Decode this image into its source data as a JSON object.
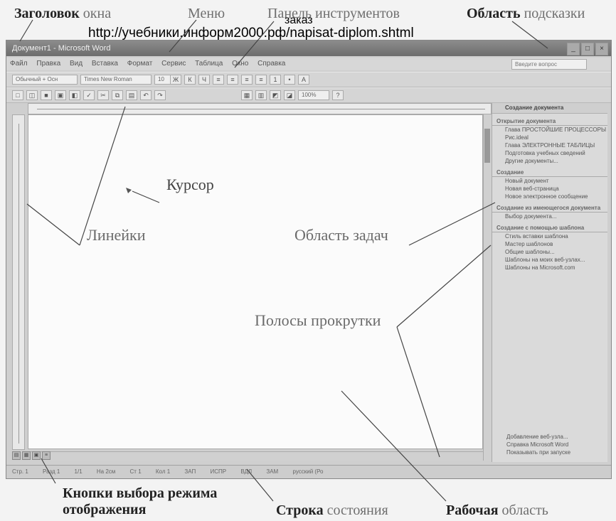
{
  "overlay": {
    "word": "заказ",
    "url": "http://учебники.информ2000.рф/napisat-diplom.shtml"
  },
  "top_labels": {
    "title_window_bold": "Заголовок",
    "title_window_rest": "окна",
    "menu": "Меню",
    "toolbar": "Панель инструментов",
    "help_bold": "Область",
    "help_rest": "подсказки"
  },
  "window": {
    "title": "Документ1 - Microsoft Word",
    "menu_items": [
      "Файл",
      "Правка",
      "Вид",
      "Вставка",
      "Формат",
      "Сервис",
      "Таблица",
      "Окно",
      "Справка"
    ],
    "help_box": "Введите вопрос",
    "toolbar_style": "Обычный + Осн",
    "toolbar_font": "Times New Roman",
    "toolbar_size": "10",
    "zoom": "100%"
  },
  "task_pane": {
    "title": "Создание документа",
    "sections": [
      {
        "title": "Открытие документа",
        "items": [
          "Глава ПРОСТОЙШИЕ ПРОЦЕССОРЫ",
          "Рис.ideal",
          "Глава ЭЛЕКТРОННЫЕ ТАБЛИЦЫ",
          "Подготовка учебных сведений",
          "Другие документы..."
        ]
      },
      {
        "title": "Создание",
        "items": [
          "Новый документ",
          "Новая веб-страница",
          "Новое электронное сообщение"
        ]
      },
      {
        "title": "Создание из имеющегося документа",
        "items": [
          "Выбор документа..."
        ]
      },
      {
        "title": "Создание с помощью шаблона",
        "items": [
          "Стиль вставки шаблона",
          "Мастер шаблонов",
          "Общие шаблоны...",
          "Шаблоны на моих веб-узлах...",
          "Шаблоны на Microsoft.com"
        ]
      }
    ],
    "footer_items": [
      "Добавление веб-узла...",
      "Справка Microsoft Word",
      "Показывать при запуске"
    ]
  },
  "statusbar": {
    "items": [
      "Стр. 1",
      "Разд 1",
      "1/1",
      "На 2см",
      "Ст 1",
      "Кол 1",
      "ЗАП",
      "ИСПР",
      "ВДЛ",
      "ЗАМ",
      "русский (Ро"
    ]
  },
  "annotations": {
    "cursor": "Курсор",
    "rulers": "Линейки",
    "task_area": "Область задач",
    "scrollbars": "Полосы прокрутки",
    "view_buttons_line1": "Кнопки выбора режима",
    "view_buttons_line2": "отображения",
    "statusbar_bold": "Строка",
    "statusbar_rest": "состояния",
    "workspace_bold": "Рабочая",
    "workspace_rest": "область"
  }
}
